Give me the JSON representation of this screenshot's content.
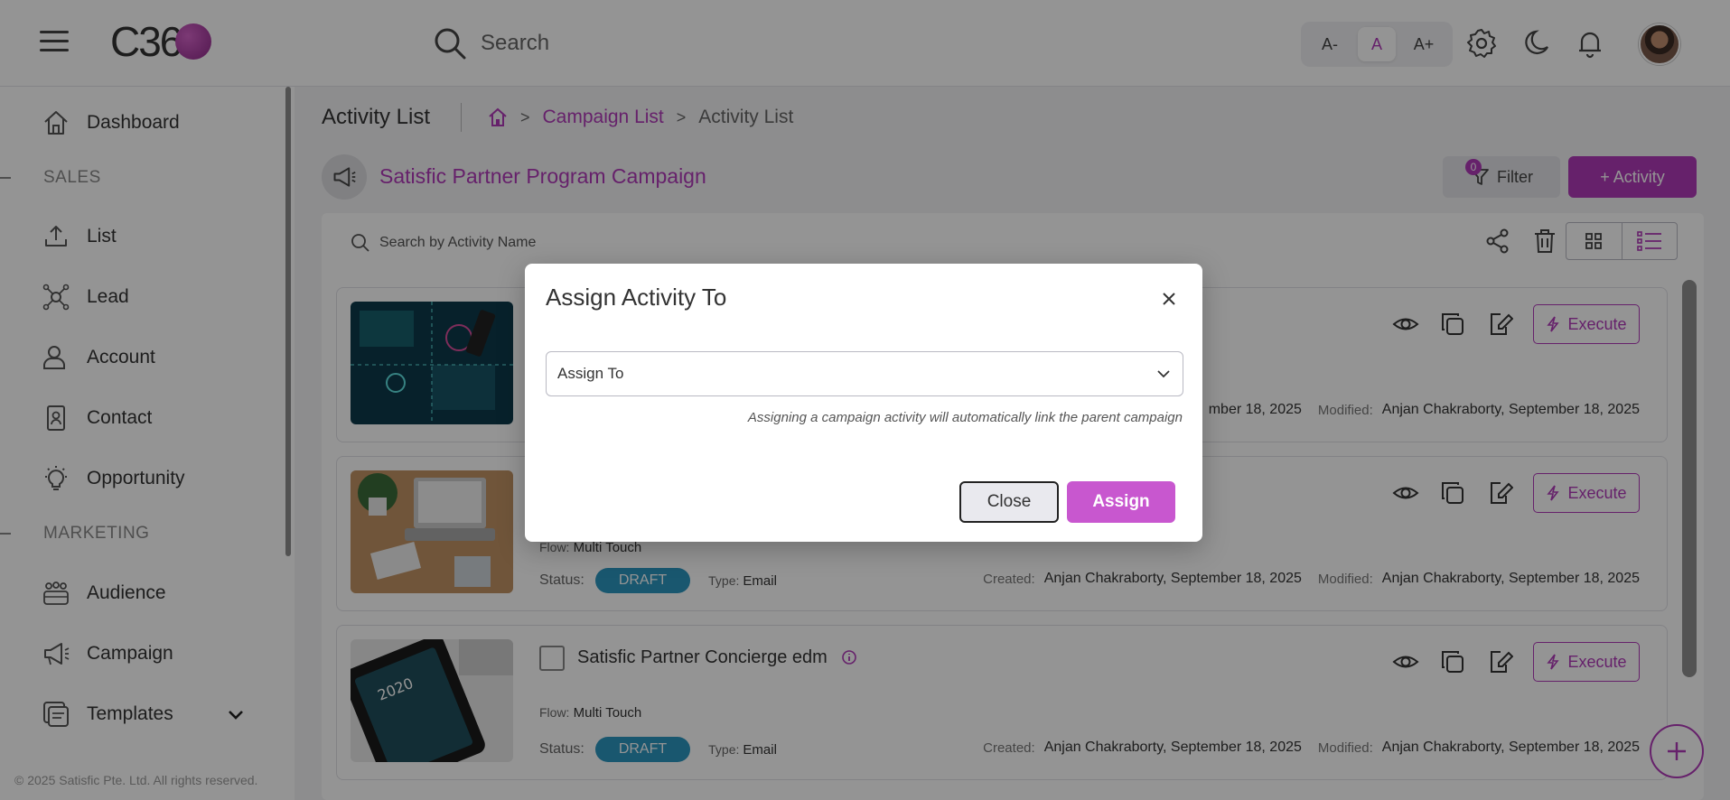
{
  "header": {
    "logo_text": "C36",
    "search_placeholder": "Search",
    "font_controls": [
      "A-",
      "A",
      "A+"
    ]
  },
  "sidebar": {
    "items": [
      {
        "label": "Dashboard",
        "icon": "home-icon"
      },
      {
        "label": "List",
        "icon": "upload-icon"
      },
      {
        "label": "Lead",
        "icon": "network-icon"
      },
      {
        "label": "Account",
        "icon": "user-account-icon"
      },
      {
        "label": "Contact",
        "icon": "contact-card-icon"
      },
      {
        "label": "Opportunity",
        "icon": "lightbulb-icon"
      },
      {
        "label": "Audience",
        "icon": "group-icon"
      },
      {
        "label": "Campaign",
        "icon": "megaphone-icon"
      },
      {
        "label": "Templates",
        "icon": "templates-icon"
      }
    ],
    "sections": [
      "SALES",
      "MARKETING"
    ],
    "footer": "© 2025 Satisfic Pte. Ltd. All rights reserved."
  },
  "main": {
    "page_title": "Activity List",
    "breadcrumb": [
      "Campaign List",
      "Activity List"
    ],
    "campaign_title": "Satisfic Partner Program Campaign",
    "filter_label": "Filter",
    "filter_count": "0",
    "add_activity_label": "+ Activity",
    "search_placeholder": "Search by Activity Name",
    "cards": [
      {
        "name": "",
        "flow_label": "",
        "flow_value": "",
        "created_label": "",
        "created_value": "mber 18, 2025",
        "modified_label": "Modified:",
        "modified_value": "Anjan Chakraborty, September 18, 2025",
        "execute_label": "Execute"
      },
      {
        "name": "",
        "flow_label": "Flow:",
        "flow_value": "Multi Touch",
        "status_label": "Status:",
        "status": "DRAFT",
        "type_label": "Type:",
        "type": "Email",
        "created_label": "Created:",
        "created_value": "Anjan Chakraborty, September 18, 2025",
        "modified_label": "Modified:",
        "modified_value": "Anjan Chakraborty, September 18, 2025",
        "execute_label": "Execute"
      },
      {
        "name": "Satisfic Partner Concierge edm",
        "flow_label": "Flow:",
        "flow_value": "Multi Touch",
        "status_label": "Status:",
        "status": "DRAFT",
        "type_label": "Type:",
        "type": "Email",
        "created_label": "Created:",
        "created_value": "Anjan Chakraborty, September 18, 2025",
        "modified_label": "Modified:",
        "modified_value": "Anjan Chakraborty, September 18, 2025",
        "execute_label": "Execute"
      }
    ]
  },
  "modal": {
    "title": "Assign Activity To",
    "select_value": "Assign To",
    "hint": "Assigning a campaign activity will automatically link the parent campaign",
    "close_label": "Close",
    "assign_label": "Assign"
  },
  "colors": {
    "accent": "#b03ab8",
    "status_draft": "#2b96c0",
    "assign_button": "#c857cf"
  }
}
